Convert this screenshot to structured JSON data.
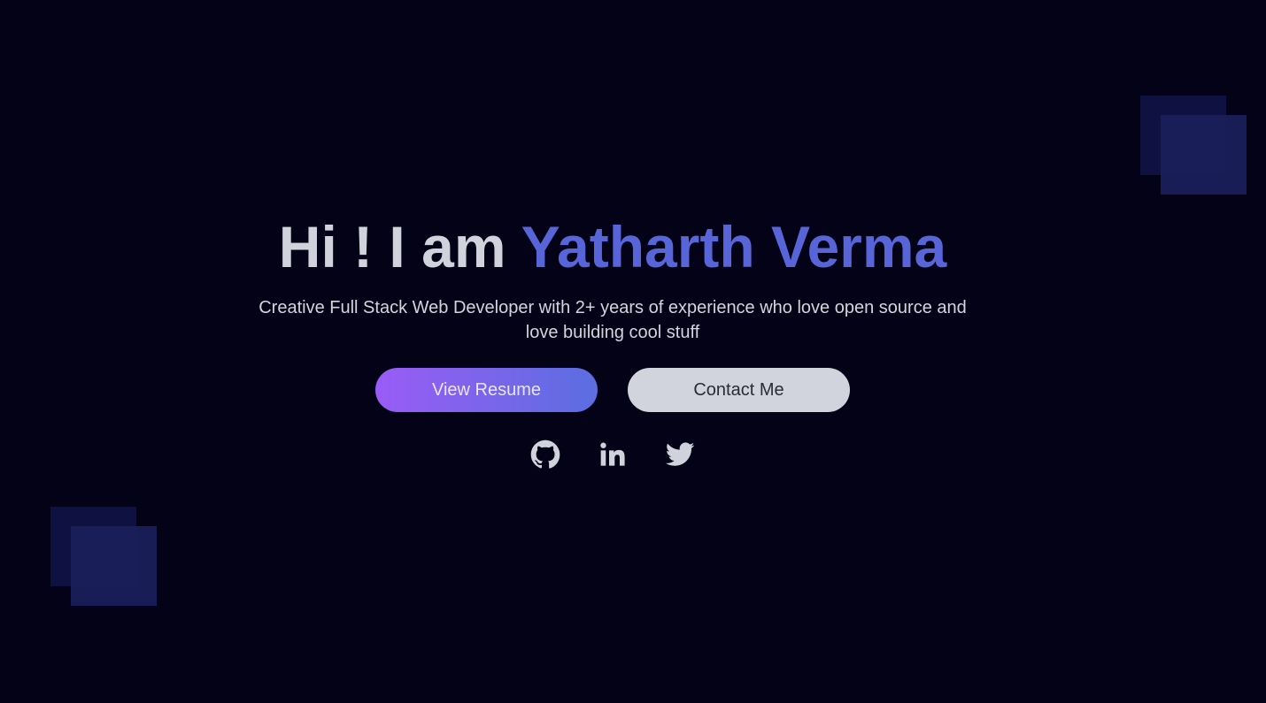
{
  "hero": {
    "greeting": "Hi ! I am ",
    "name": "Yatharth Verma",
    "subtitle": "Creative Full Stack Web Developer with 2+ years of experience who love open source and love building cool stuff"
  },
  "actions": {
    "resume_label": "View Resume",
    "contact_label": "Contact Me"
  },
  "socials": [
    {
      "icon": "github-icon"
    },
    {
      "icon": "linkedin-icon"
    },
    {
      "icon": "twitter-icon"
    }
  ],
  "colors": {
    "background": "#030216",
    "accent": "#5865d8",
    "text": "#d1d3dc",
    "gradient_start": "#9a5cf6",
    "gradient_end": "#5b6ee0"
  }
}
